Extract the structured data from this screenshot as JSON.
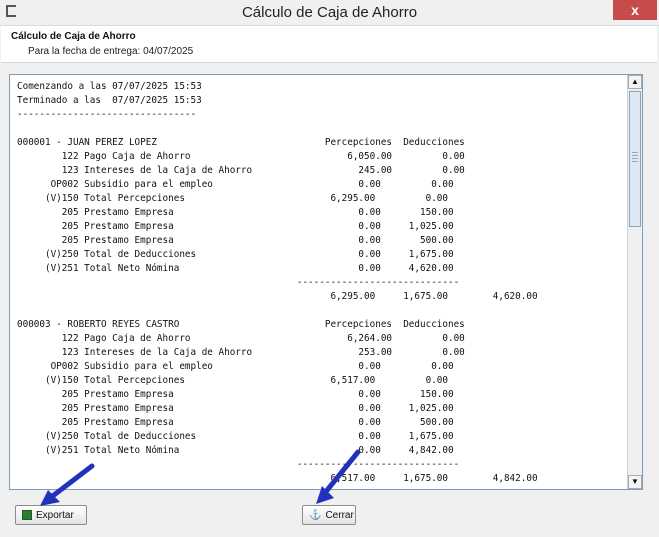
{
  "window": {
    "title": "Cálculo de Caja de Ahorro",
    "close_label": "x"
  },
  "header": {
    "title": "Cálculo de Caja de Ahorro",
    "subtitle": "Para la fecha de entrega: 04/07/2025"
  },
  "report": {
    "lines": [
      "Comenzando a las 07/07/2025 15:53",
      "Terminado a las  07/07/2025 15:53",
      "--------------------------------",
      "",
      "000001 - JUAN PEREZ LOPEZ                              Percepciones  Deducciones",
      "        122 Pago Caja de Ahorro                            6,050.00         0.00",
      "        123 Intereses de la Caja de Ahorro                   245.00         0.00",
      "      OP002 Subsidio para el empleo                          0.00         0.00",
      "     (V)150 Total Percepciones                          6,295.00         0.00",
      "        205 Prestamo Empresa                                 0.00       150.00",
      "        205 Prestamo Empresa                                 0.00     1,025.00",
      "        205 Prestamo Empresa                                 0.00       500.00",
      "     (V)250 Total de Deducciones                             0.00     1,675.00",
      "     (V)251 Total Neto Nómina                                0.00     4,620.00",
      "                                                  -----------------------------",
      "                                                        6,295.00     1,675.00        4,620.00",
      "",
      "000003 - ROBERTO REYES CASTRO                          Percepciones  Deducciones",
      "        122 Pago Caja de Ahorro                            6,264.00         0.00",
      "        123 Intereses de la Caja de Ahorro                   253.00         0.00",
      "      OP002 Subsidio para el empleo                          0.00         0.00",
      "     (V)150 Total Percepciones                          6,517.00         0.00",
      "        205 Prestamo Empresa                                 0.00       150.00",
      "        205 Prestamo Empresa                                 0.00     1,025.00",
      "        205 Prestamo Empresa                                 0.00       500.00",
      "     (V)250 Total de Deducciones                             0.00     1,675.00",
      "     (V)251 Total Neto Nómina                                0.00     4,842.00",
      "                                                  -----------------------------",
      "                                                        6,517.00     1,675.00        4,842.00"
    ]
  },
  "buttons": {
    "export_label": "Exportar",
    "close_label": "Cerrar"
  },
  "scrollbar": {
    "up_arrow": "▲",
    "down_arrow": "▼"
  },
  "colors": {
    "close_button": "#c74b4b",
    "pointer_arrow": "#2233bb"
  }
}
